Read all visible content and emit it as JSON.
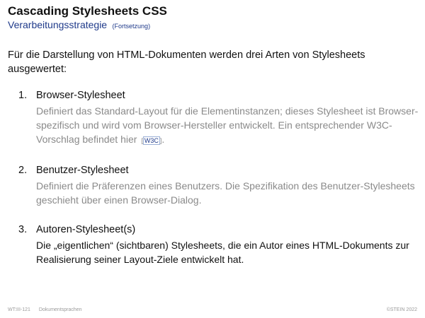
{
  "header": {
    "title": "Cascading Stylesheets CSS",
    "subtitle": "Verarbeitungsstrategie",
    "subtitle_note": "(Fortsetzung)"
  },
  "intro": "Für die Darstellung von HTML-Dokumenten werden drei Arten von Stylesheets ausgewertet:",
  "items": [
    {
      "number": "1.",
      "title": "Browser-Stylesheet",
      "description": "Definiert das Standard-Layout für die Elementinstanzen; dieses Stylesheet ist Browser-spezifisch und wird vom Browser-Hersteller entwickelt. Ein entsprechender W3C-Vorschlag befindet hier",
      "ref_open": "[",
      "ref_label": "W3C",
      "ref_close": "]",
      "ref_suffix": "."
    },
    {
      "number": "2.",
      "title": "Benutzer-Stylesheet",
      "description": "Definiert die Präferenzen eines Benutzers. Die Spezifikation des Benutzer-Stylesheets geschieht über einen Browser-Dialog."
    },
    {
      "number": "3.",
      "title": "Autoren-Stylesheet(s)",
      "description": "Die „eigentlichen“ (sichtbaren) Stylesheets, die ein Autor eines HTML-Dokuments zur Realisierung seiner Layout-Ziele entwickelt hat."
    }
  ],
  "footer": {
    "slide_number": "WT:III-121",
    "course": "Dokumentsprachen",
    "copyright": "©STEIN 2022"
  },
  "colors": {
    "title": "#111111",
    "subtitle": "#1f3a8a",
    "description": "#8a8a8a",
    "footer": "#9a9a9a",
    "link": "#1f3a8a"
  }
}
